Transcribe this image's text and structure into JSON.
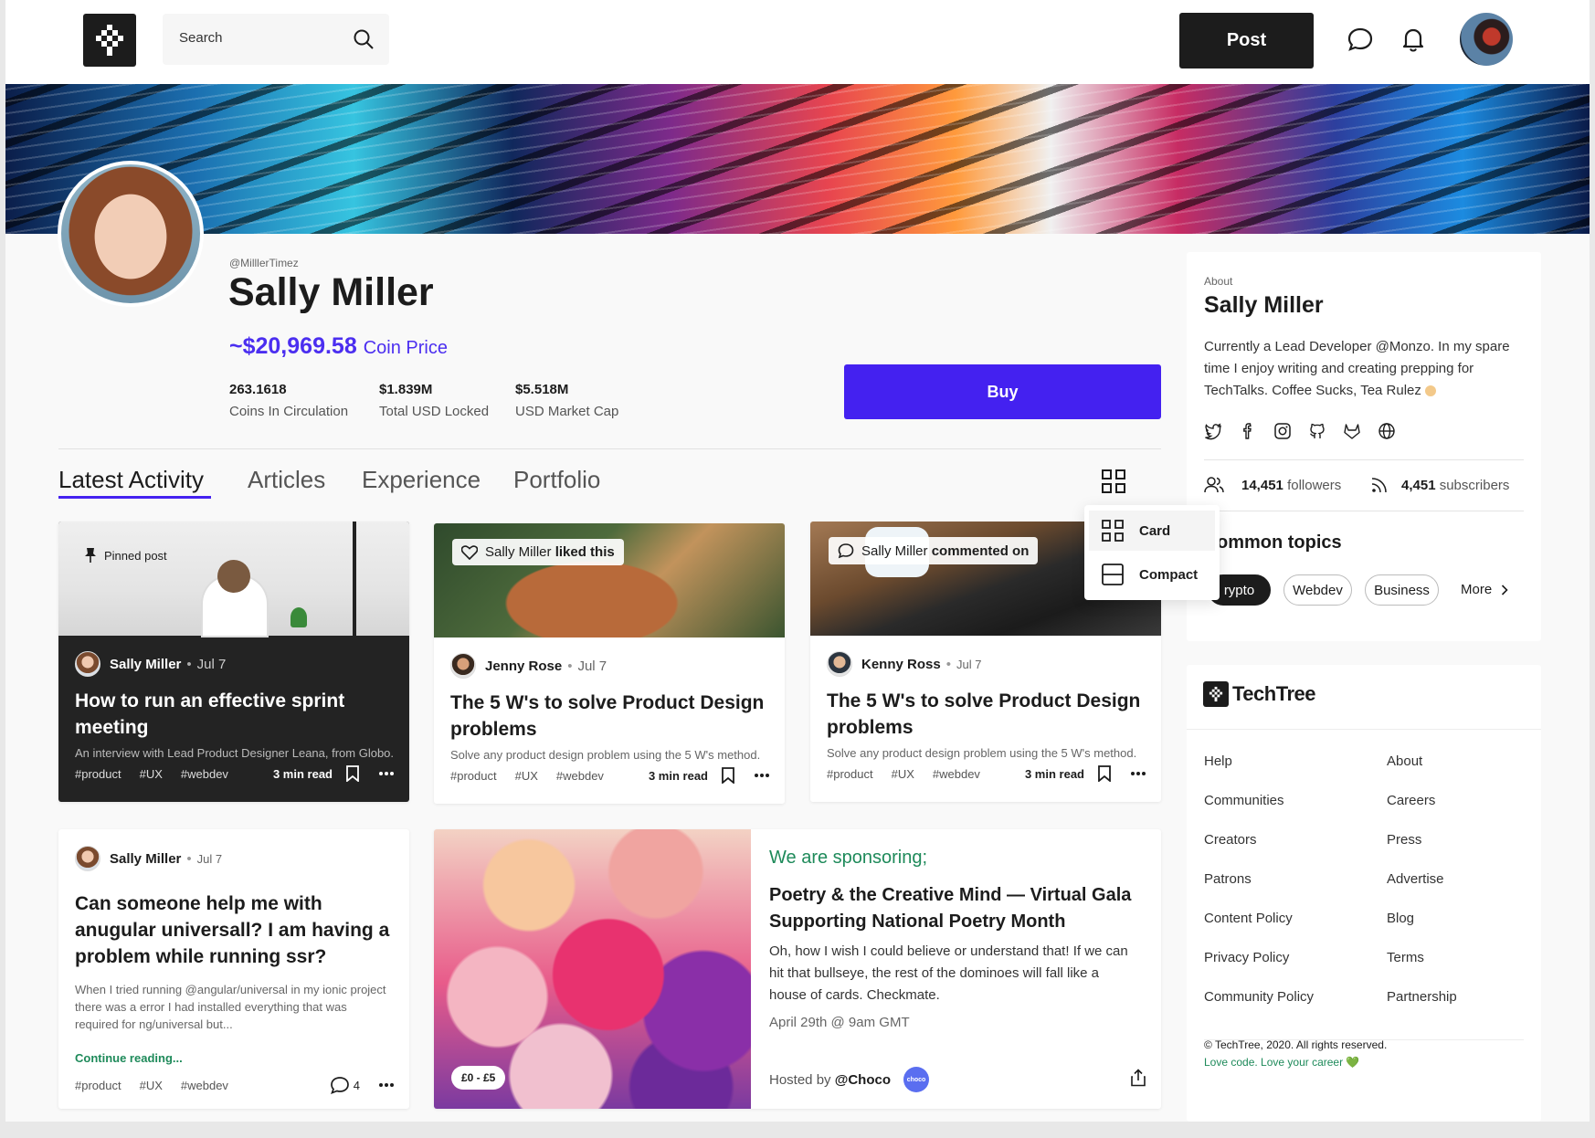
{
  "header": {
    "search_placeholder": "Search",
    "post_label": "Post"
  },
  "profile": {
    "handle": "@MilllerTimez",
    "name": "Sally Miller",
    "price_value": "~$20,969.58",
    "price_label": "Coin Price",
    "stats": [
      {
        "value": "263.1618",
        "label": "Coins In Circulation"
      },
      {
        "value": "$1.839M",
        "label": "Total USD Locked"
      },
      {
        "value": "$5.518M",
        "label": "USD Market Cap"
      }
    ],
    "buy_label": "Buy"
  },
  "tabs": [
    "Latest Activity",
    "Articles",
    "Experience",
    "Portfolio"
  ],
  "view_menu": {
    "card": "Card",
    "compact": "Compact"
  },
  "cards": [
    {
      "chip": "Pinned post",
      "author": "Sally Miller",
      "date": "Jul 7",
      "title_line1": "How to run an effective sprint",
      "title_line2": "meeting",
      "desc": "An interview with Lead Product Designer Leana, from Globo.",
      "tags": [
        "#product",
        "#UX",
        "#webdev"
      ],
      "read": "3 min read"
    },
    {
      "chip_name": "Sally Miller",
      "chip_action": "liked this",
      "author": "Jenny Rose",
      "date": "Jul 7",
      "title_line1": "The 5 W's to solve Product Design",
      "title_line2": "problems",
      "desc": "Solve any product design problem using the 5 W's method.",
      "tags": [
        "#product",
        "#UX",
        "#webdev"
      ],
      "read": "3 min read"
    },
    {
      "chip_name": "Sally Miller",
      "chip_action": "commented on",
      "author": "Kenny Ross",
      "date": "Jul 7",
      "title_line1": "The 5 W's to solve Product Design",
      "title_line2": "problems",
      "desc": "Solve any product design problem using the 5 W's method.",
      "tags": [
        "#product",
        "#UX",
        "#webdev"
      ],
      "read": "3 min read"
    },
    {
      "author": "Sally Miller",
      "date": "Jul 7",
      "title_line1": "Can someone help me with",
      "title_line2": "anugular universall? I am having a",
      "title_line3": "problem while running ssr?",
      "body_line1": "When I tried running @angular/universal in my ionic project",
      "body_line2": "there was a error I had installed everything that was",
      "body_line3": "required for ng/universal but...",
      "continue": "Continue reading...",
      "tags": [
        "#product",
        "#UX",
        "#webdev"
      ],
      "comments": "4"
    }
  ],
  "sponsor": {
    "price_chip": "£0 - £5",
    "kicker": "We are sponsoring;",
    "title_line1": "Poetry & the Creative Mind — Virtual Gala",
    "title_line2": "Supporting National Poetry Month",
    "body_line1": "Oh, how I wish I could believe or understand that! If we can",
    "body_line2": "hit that bullseye, the rest of the dominoes will fall like a",
    "body_line3": "house of cards. Checkmate.",
    "when": "April 29th @ 9am GMT",
    "hosted_prefix": "Hosted by",
    "host": "@Choco",
    "host_badge": "choco"
  },
  "about": {
    "label": "About",
    "name": "Sally Miller",
    "bio_line1": "Currently a Lead Developer @Monzo. In my spare",
    "bio_line2": "time I enjoy writing and creating prepping for",
    "bio_line3": "TechTalks. Coffee Sucks, Tea Rulez",
    "followers_count": "14,451",
    "followers_label": "followers",
    "subscribers_count": "4,451",
    "subscribers_label": "subscribers",
    "topics_title": "ommon topics",
    "topics": [
      "rypto",
      "Webdev",
      "Business"
    ],
    "more": "More"
  },
  "brand": {
    "name": "TechTree",
    "links_left": [
      "Help",
      "Communities",
      "Creators",
      "Patrons",
      "Content Policy",
      "Privacy Policy",
      "Community Policy"
    ],
    "links_right": [
      "About",
      "Careers",
      "Press",
      "Advertise",
      "Blog",
      "Terms",
      "Partnership"
    ],
    "copyright": "© TechTree, 2020. All rights reserved.",
    "tagline": "Love code. Love your career 💚"
  },
  "colors": {
    "accent": "#4421f0",
    "green": "#1e8a5a"
  }
}
